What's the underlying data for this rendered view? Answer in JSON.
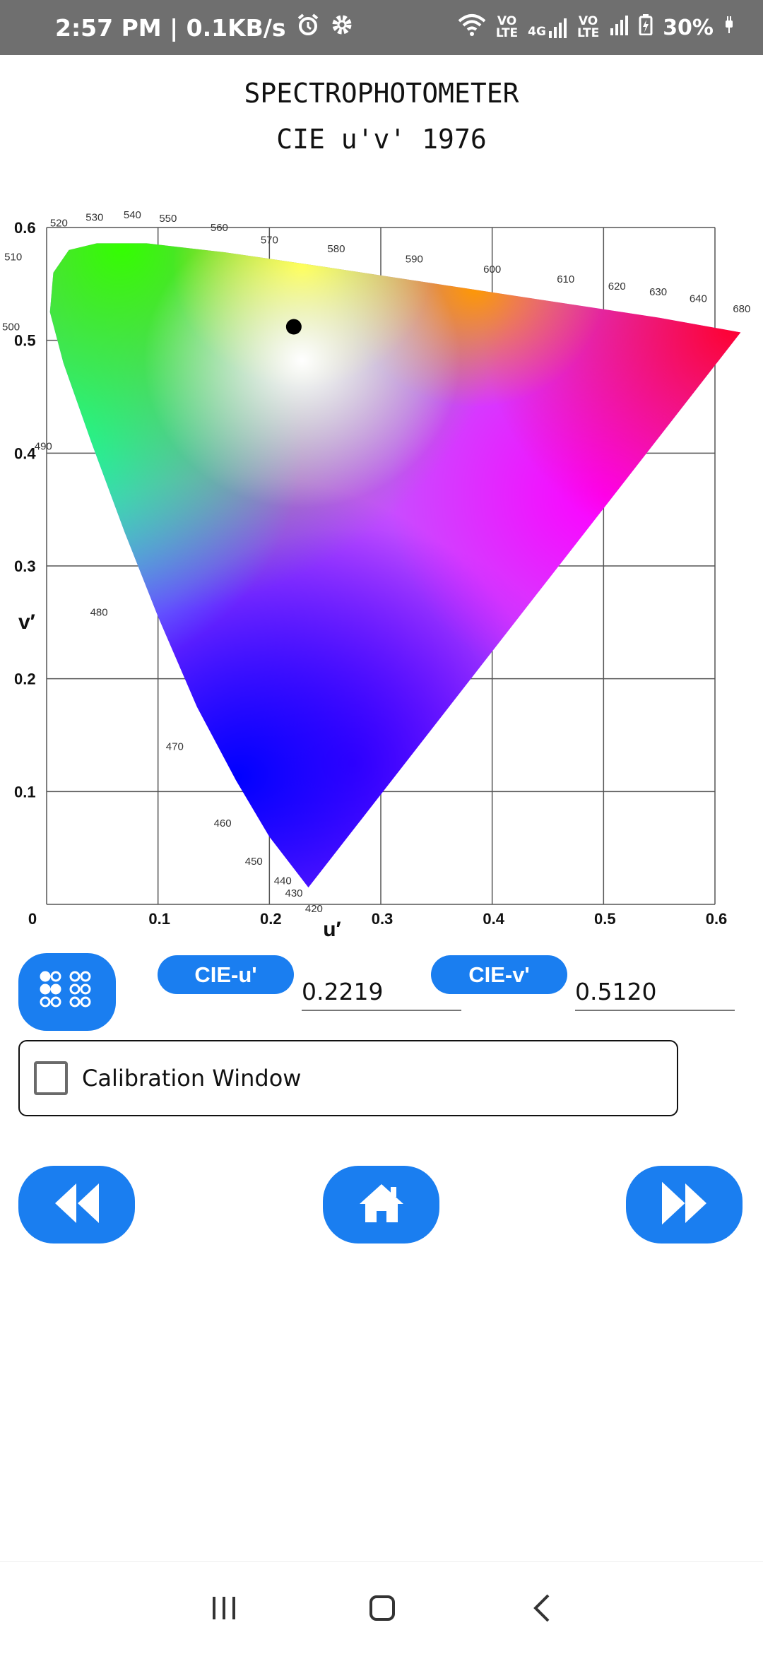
{
  "status_bar": {
    "time_speed": "2:57 PM | 0.1KB/s",
    "icons": [
      "alarm-icon",
      "gear-icon",
      "wifi-icon",
      "volte-icon",
      "4g-signal-icon",
      "volte-icon",
      "signal-icon",
      "battery-charging-icon"
    ],
    "volte_label_top": "VO",
    "volte_label_bottom": "LTE",
    "network_label": "4G",
    "battery": "30%"
  },
  "header": {
    "title": "SPECTROPHOTOMETER",
    "subtitle": "CIE u'v' 1976"
  },
  "chart_data": {
    "type": "scatter",
    "xlabel": "u′",
    "ylabel": "v′",
    "xlim": [
      0,
      0.6
    ],
    "ylim": [
      0,
      0.6
    ],
    "x_ticks": [
      "0",
      "0.1",
      "0.2",
      "0.3",
      "0.4",
      "0.5",
      "0.6"
    ],
    "y_ticks": [
      "0.1",
      "0.2",
      "0.3",
      "0.4",
      "0.5",
      "0.6"
    ],
    "grid": true,
    "background": "CIE 1976 u'v' chromaticity diagram",
    "wavelength_labels": [
      {
        "nm": "420",
        "u": 0.24,
        "v": -0.007
      },
      {
        "nm": "430",
        "u": 0.222,
        "v": 0.007
      },
      {
        "nm": "440",
        "u": 0.212,
        "v": 0.018
      },
      {
        "nm": "450",
        "u": 0.186,
        "v": 0.035
      },
      {
        "nm": "460",
        "u": 0.158,
        "v": 0.069
      },
      {
        "nm": "470",
        "u": 0.115,
        "v": 0.137
      },
      {
        "nm": "480",
        "u": 0.047,
        "v": 0.256
      },
      {
        "nm": "490",
        "u": -0.003,
        "v": 0.403
      },
      {
        "nm": "500",
        "u": -0.032,
        "v": 0.509
      },
      {
        "nm": "510",
        "u": -0.03,
        "v": 0.571
      },
      {
        "nm": "520",
        "u": 0.011,
        "v": 0.601
      },
      {
        "nm": "530",
        "u": 0.043,
        "v": 0.606
      },
      {
        "nm": "540",
        "u": 0.077,
        "v": 0.608
      },
      {
        "nm": "550",
        "u": 0.109,
        "v": 0.605
      },
      {
        "nm": "560",
        "u": 0.155,
        "v": 0.597
      },
      {
        "nm": "570",
        "u": 0.2,
        "v": 0.586
      },
      {
        "nm": "580",
        "u": 0.26,
        "v": 0.578
      },
      {
        "nm": "590",
        "u": 0.33,
        "v": 0.569
      },
      {
        "nm": "600",
        "u": 0.4,
        "v": 0.56
      },
      {
        "nm": "610",
        "u": 0.466,
        "v": 0.551
      },
      {
        "nm": "620",
        "u": 0.512,
        "v": 0.545
      },
      {
        "nm": "630",
        "u": 0.549,
        "v": 0.54
      },
      {
        "nm": "640",
        "u": 0.585,
        "v": 0.534
      },
      {
        "nm": "680",
        "u": 0.624,
        "v": 0.525
      }
    ],
    "measured_point": {
      "u": 0.2219,
      "v": 0.512
    }
  },
  "controls": {
    "menu_icon": "keypad-grid-icon",
    "cie_u_label": "CIE-u'",
    "cie_u_value": "0.2219",
    "cie_v_label": "CIE-v'",
    "cie_v_value": "0.5120",
    "calibration_label": "Calibration Window",
    "calibration_checked": false
  },
  "navigation": {
    "prev_icon": "rewind-icon",
    "home_icon": "home-icon",
    "next_icon": "fast-forward-icon"
  },
  "colors": {
    "accent": "#1a7ef0",
    "status_bar": "#6f6f6f"
  }
}
